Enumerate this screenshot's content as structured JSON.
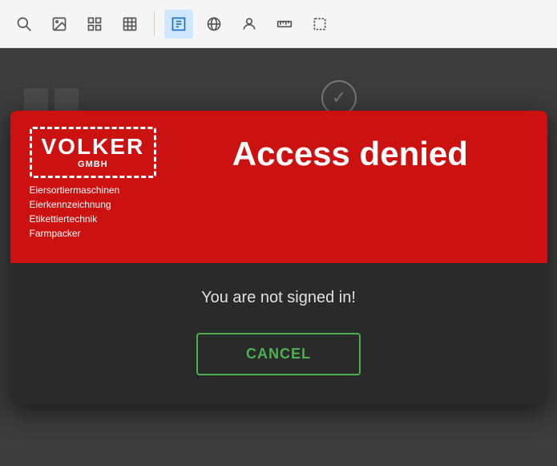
{
  "toolbar": {
    "icons": [
      {
        "name": "search-icon",
        "symbol": "🔍",
        "active": false
      },
      {
        "name": "image-icon",
        "symbol": "🖼",
        "active": false
      },
      {
        "name": "grid-icon",
        "symbol": "⊞",
        "active": false
      },
      {
        "name": "table-icon",
        "symbol": "▦",
        "active": false
      },
      {
        "name": "edit-icon",
        "symbol": "✏",
        "active": true
      },
      {
        "name": "globe-icon",
        "symbol": "🌐",
        "active": false
      },
      {
        "name": "user-icon",
        "symbol": "👤",
        "active": false
      },
      {
        "name": "ruler-icon",
        "symbol": "📐",
        "active": false
      },
      {
        "name": "crop-icon",
        "symbol": "⬜",
        "active": false
      }
    ]
  },
  "modal": {
    "logo": {
      "brand": "VOLKER",
      "sub": "GMBH",
      "taglines": [
        "Eiersortiermaschinen",
        "Eierkennzeichnung",
        "Etikettiertechnik",
        "Farmpacker"
      ]
    },
    "title": "Access denied",
    "message": "You are not signed in!",
    "cancel_button_label": "CANCEL"
  },
  "colors": {
    "header_bg": "#cc1111",
    "body_bg": "#2a2a2a",
    "button_color": "#4caf50",
    "title_color": "#ffffff",
    "message_color": "#e0e0e0"
  }
}
